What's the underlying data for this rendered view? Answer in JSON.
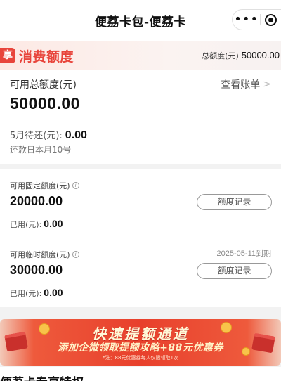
{
  "window": {
    "title": "便荔卡包-便荔卡"
  },
  "capsule": {
    "more_icon": "more-dots-icon",
    "close_icon": "target-icon"
  },
  "header": {
    "badge_char": "享",
    "brand": "消费额度",
    "total_label": "总额度(元)",
    "total_value": "50000.00"
  },
  "main": {
    "available_label": "可用总额度(元)",
    "bill_link": "查看账单",
    "bill_chevron": ">",
    "available_value": "50000.00",
    "due_label": "5月待还(元):",
    "due_value": "0.00",
    "repay_note": "还款日本月10号"
  },
  "limits": [
    {
      "label": "可用固定额度(元)",
      "expire": "",
      "value": "20000.00",
      "record_button": "额度记录",
      "used_label": "已用(元):",
      "used_value": "0.00"
    },
    {
      "label": "可用临时额度(元)",
      "expire": "2025-05-11到期",
      "value": "30000.00",
      "record_button": "额度记录",
      "used_label": "已用(元):",
      "used_value": "0.00"
    }
  ],
  "banner": {
    "title": "快速提额通道",
    "subtitle": "添加企微领取提额攻略+88元优惠券",
    "note": "*注：88元优惠券每人仅限领取1次"
  },
  "section": {
    "title": "便荔卡专享特权"
  },
  "colors": {
    "accent": "#e8453c",
    "banner": "#e8402c"
  }
}
